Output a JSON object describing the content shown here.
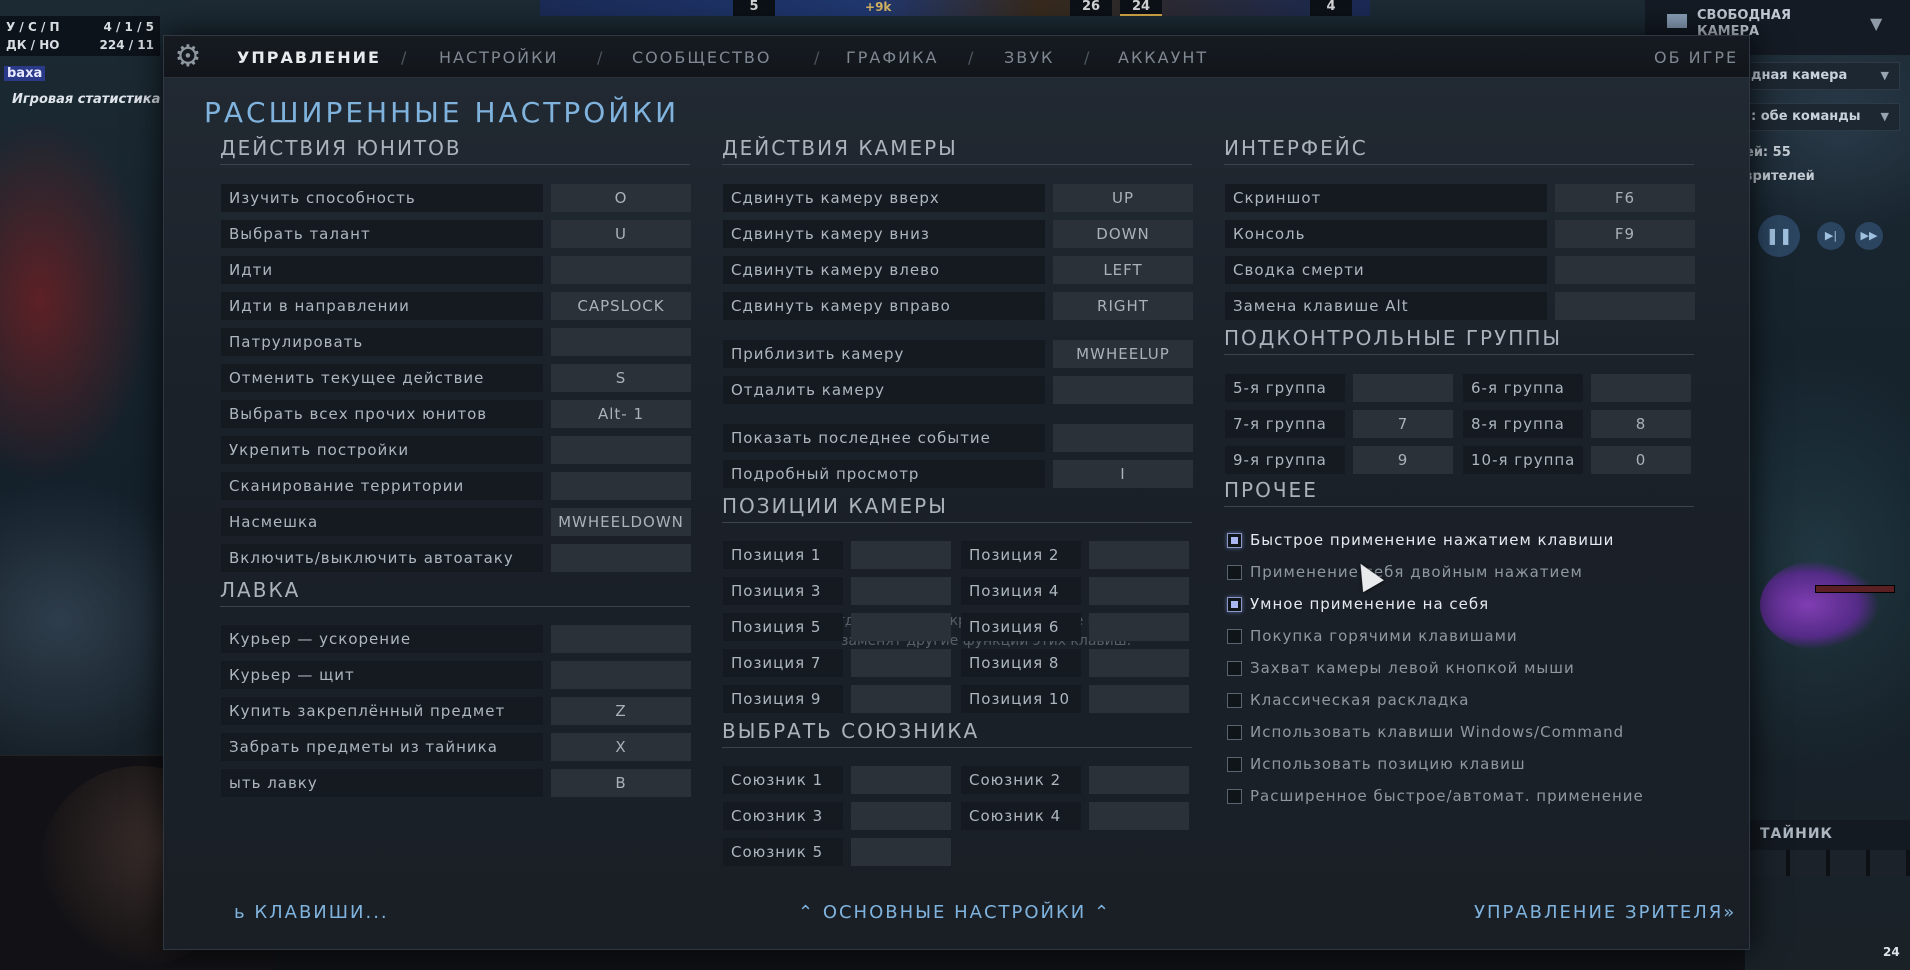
{
  "hud": {
    "top_numbers": [
      "5",
      "26",
      "24",
      "4"
    ],
    "gold": "9k",
    "kda_label1": "У / С / П",
    "kda_value1": "4 / 1 / 5",
    "kda_label2": "ДК / НО",
    "kda_value2": "224 / 11",
    "player_name": "baxa",
    "game_stats_label": "Игровая статистика",
    "camera_title": "СВОБОДНАЯ КАМЕРА",
    "camera_dropdown1": "дная камера",
    "camera_dropdown2": ": обе команды",
    "stat1": "ей: 55",
    "stat2": "зрителей",
    "stash_label": "ТАЙНИК",
    "corner_num": "24"
  },
  "nav": {
    "tabs": [
      "УПРАВЛЕНИЕ",
      "НАСТРОЙКИ",
      "СООБЩЕСТВО",
      "ГРАФИКА",
      "ЗВУК",
      "АККАУНТ"
    ],
    "about": "ОБ ИГРЕ"
  },
  "panel_title": "РАСШИРЕННЫЕ НАСТРОЙКИ",
  "sections": {
    "unit_actions": {
      "title": "ДЕЙСТВИЯ ЮНИТОВ",
      "rows": [
        {
          "label": "Изучить способность",
          "key": "O"
        },
        {
          "label": "Выбрать талант",
          "key": "U"
        },
        {
          "label": "Идти",
          "key": ""
        },
        {
          "label": "Идти в направлении",
          "key": "CAPSLOCK"
        },
        {
          "label": "Патрулировать",
          "key": ""
        },
        {
          "label": "Отменить текущее действие",
          "key": "S"
        },
        {
          "label": "Выбрать всех прочих юнитов",
          "key": "Alt- 1"
        },
        {
          "label": "Укрепить постройки",
          "key": ""
        },
        {
          "label": "Сканирование территории",
          "key": ""
        },
        {
          "label": "Насмешка",
          "key": "MWHEELDOWN"
        },
        {
          "label": "Включить/выключить автоатаку",
          "key": ""
        }
      ]
    },
    "shop": {
      "title": "ЛАВКА",
      "rows": [
        {
          "label": "Курьер — ускорение",
          "key": ""
        },
        {
          "label": "Курьер — щит",
          "key": ""
        },
        {
          "label": "Купить закреплённый предмет",
          "key": "Z"
        },
        {
          "label": "Забрать предметы из тайника",
          "key": "X"
        },
        {
          "label": "ыть лавку",
          "key": "B"
        }
      ]
    },
    "camera_actions": {
      "title": "ДЕЙСТВИЯ КАМЕРЫ",
      "rows": [
        {
          "label": "Сдвинуть камеру вверх",
          "key": "UP"
        },
        {
          "label": "Сдвинуть камеру вниз",
          "key": "DOWN"
        },
        {
          "label": "Сдвинуть камеру влево",
          "key": "LEFT"
        },
        {
          "label": "Сдвинуть камеру вправо",
          "key": "RIGHT"
        },
        {
          "label": "Приблизить камеру",
          "key": "MWHEELUP"
        },
        {
          "label": "Отдалить камеру",
          "key": ""
        },
        {
          "label": "Показать последнее событие",
          "key": ""
        },
        {
          "label": "Подробный просмотр",
          "key": "I"
        }
      ]
    },
    "camera_positions": {
      "title": "ПОЗИЦИИ КАМЕРЫ",
      "items": [
        {
          "label": "Позиция 1",
          "key": ""
        },
        {
          "label": "Позиция 2",
          "key": ""
        },
        {
          "label": "Позиция 3",
          "key": ""
        },
        {
          "label": "Позиция 4",
          "key": ""
        },
        {
          "label": "Позиция 5",
          "key": ""
        },
        {
          "label": "Позиция 6",
          "key": ""
        },
        {
          "label": "Позиция 7",
          "key": ""
        },
        {
          "label": "Позиция 8",
          "key": ""
        },
        {
          "label": "Позиция 9",
          "key": ""
        },
        {
          "label": "Позиция 10",
          "key": ""
        }
      ]
    },
    "select_ally": {
      "title": "ВЫБРАТЬ СОЮЗНИКА",
      "items": [
        {
          "label": "Союзник 1",
          "key": ""
        },
        {
          "label": "Союзник 2",
          "key": ""
        },
        {
          "label": "Союзник 3",
          "key": ""
        },
        {
          "label": "Союзник 4",
          "key": ""
        },
        {
          "label": "Союзник 5",
          "key": ""
        }
      ]
    },
    "interface": {
      "title": "ИНТЕРФЕЙС",
      "rows": [
        {
          "label": "Скриншот",
          "key": "F6"
        },
        {
          "label": "Консоль",
          "key": "F9"
        },
        {
          "label": "Сводка смерти",
          "key": ""
        },
        {
          "label": "Замена клавише Alt",
          "key": ""
        }
      ]
    },
    "control_groups": {
      "title": "ПОДКОНТРОЛЬНЫЕ ГРУППЫ",
      "items": [
        {
          "label": "5-я группа",
          "key": ""
        },
        {
          "label": "6-я группа",
          "key": ""
        },
        {
          "label": "7-я группа",
          "key": "7"
        },
        {
          "label": "8-я группа",
          "key": "8"
        },
        {
          "label": "9-я группа",
          "key": "9"
        },
        {
          "label": "10-я группа",
          "key": "0"
        }
      ]
    },
    "other": {
      "title": "ПРОЧЕЕ",
      "options": [
        {
          "label": "Быстрое применение нажатием клавиши",
          "checked": true
        },
        {
          "label": "Применение   себя двойным нажатием",
          "checked": false
        },
        {
          "label": "Умное применение на себя",
          "checked": true
        },
        {
          "label": "Покупка горячими клавишами",
          "checked": false
        },
        {
          "label": "Захват камеры левой кнопкой мыши",
          "checked": false
        },
        {
          "label": "Классическая раскладка",
          "checked": false
        },
        {
          "label": "Использовать клавиши Windows/Command",
          "checked": false
        },
        {
          "label": "Использовать позицию клавиш",
          "checked": false
        },
        {
          "label": "Расширенное быстрое/автомат. применение",
          "checked": false
        }
      ]
    }
  },
  "overlay_note_line1": "Когда магазин открыт, его горячие клавиши",
  "overlay_note_line2": "заменят другие функции этих клавиш.",
  "bottom": {
    "left_link": "ь КЛАВИШИ...",
    "center_link": "ОСНОВНЫЕ НАСТРОЙКИ",
    "right_link": "УПРАВЛЕНИЕ ЗРИТЕЛЯ"
  },
  "colors": {
    "accent": "#7fb3dd",
    "panel_bg": "#1b2129",
    "label_bg": "#141a20",
    "key_bg": "#2a3139"
  }
}
